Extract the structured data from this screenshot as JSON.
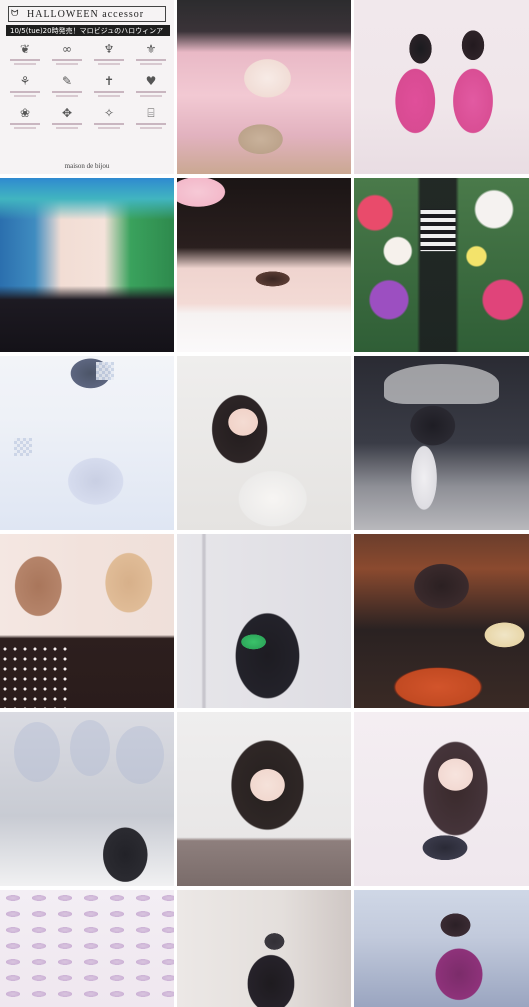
{
  "ad": {
    "title": "HALLOWEEN accessor",
    "bat_icon": "bat-icon",
    "banner": "10/5(tue)20時発売！マロビジュのハロウィンア",
    "items": [
      {
        "glyph": "❦"
      },
      {
        "glyph": "∞"
      },
      {
        "glyph": "♆"
      },
      {
        "glyph": "⚜"
      },
      {
        "glyph": "⚘"
      },
      {
        "glyph": "✎"
      },
      {
        "glyph": "✝"
      },
      {
        "glyph": "♥"
      },
      {
        "glyph": "❀"
      },
      {
        "glyph": "✥"
      },
      {
        "glyph": "✧"
      },
      {
        "glyph": "⌸"
      }
    ],
    "brand": "maison de bijou"
  },
  "tiles": [
    {
      "name": "post-halloween-accessories-ad"
    },
    {
      "name": "post-pink-hair-cat-ears"
    },
    {
      "name": "post-pink-track-jackets"
    },
    {
      "name": "post-green-hair-hush"
    },
    {
      "name": "post-eye-closeup-mask"
    },
    {
      "name": "post-flower-wall-outfit"
    },
    {
      "name": "post-mirror-selfie-tshirt"
    },
    {
      "name": "post-sailor-sleeves-pose"
    },
    {
      "name": "post-angel-wings-sitting"
    },
    {
      "name": "post-duo-polka-dots"
    },
    {
      "name": "post-duo-mirror-selfie"
    },
    {
      "name": "post-hotpot-dinner"
    },
    {
      "name": "post-manga-cutout-display"
    },
    {
      "name": "post-ribbon-bangs-claw-pose"
    },
    {
      "name": "post-peace-sign-school-uniform"
    },
    {
      "name": "post-purple-pastry-rows"
    },
    {
      "name": "post-phone-selfie-hoodie"
    },
    {
      "name": "post-masked-purple-outfit"
    }
  ]
}
